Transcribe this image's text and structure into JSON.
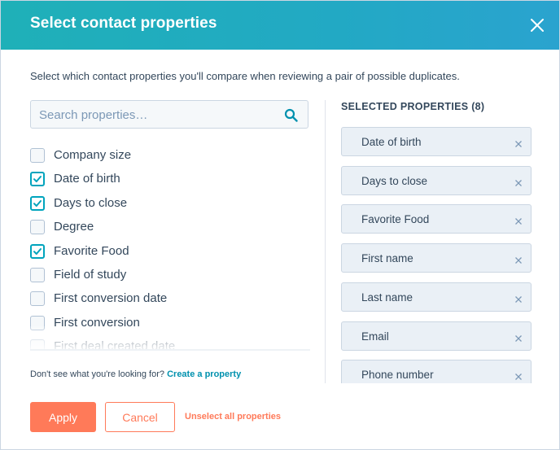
{
  "header": {
    "title": "Select contact properties"
  },
  "description": "Select which contact properties you'll compare when reviewing a pair of possible duplicates.",
  "search": {
    "placeholder": "Search properties…",
    "value": ""
  },
  "properties": [
    {
      "label": "Company size",
      "checked": false
    },
    {
      "label": "Date of birth",
      "checked": true
    },
    {
      "label": "Days to close",
      "checked": true
    },
    {
      "label": "Degree",
      "checked": false
    },
    {
      "label": "Favorite Food",
      "checked": true
    },
    {
      "label": "Field of study",
      "checked": false
    },
    {
      "label": "First conversion date",
      "checked": false
    },
    {
      "label": "First conversion",
      "checked": false
    },
    {
      "label": "First deal created date",
      "checked": false
    }
  ],
  "selected": {
    "heading": "SELECTED PROPERTIES (8)",
    "items": [
      "Date of birth",
      "Days to close",
      "Favorite Food",
      "First name",
      "Last name",
      "Email",
      "Phone number"
    ]
  },
  "help": {
    "text": "Don't see what you're looking for?",
    "link": "Create a property"
  },
  "footer": {
    "apply": "Apply",
    "cancel": "Cancel",
    "unselect": "Unselect all properties"
  },
  "colors": {
    "header": "#22a9c4",
    "accent": "#00a4bd",
    "primary": "#ff7a59",
    "link": "#0091ae"
  }
}
